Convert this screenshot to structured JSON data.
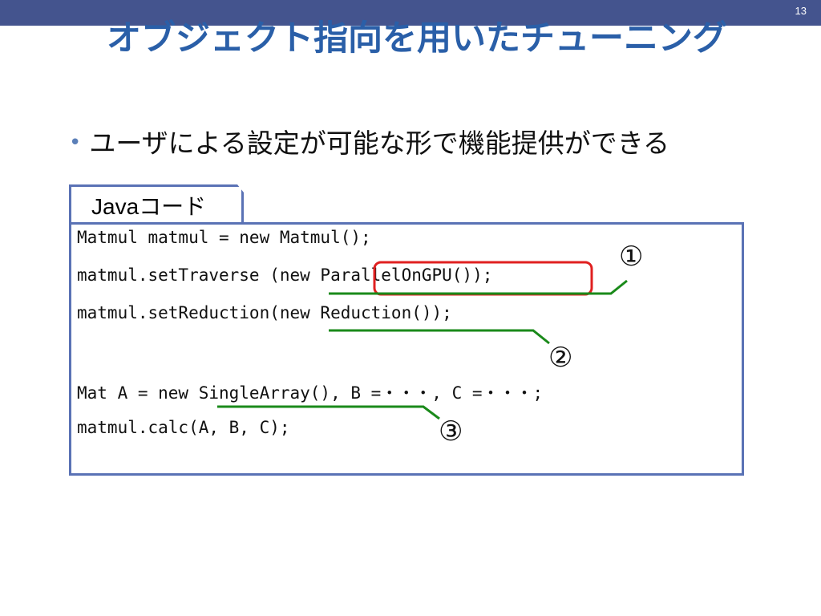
{
  "slide": {
    "page_number": "13",
    "title": "オブジェクト指向を用いたチューニング",
    "bullet": "ユーザによる設定が可能な形で機能提供ができる",
    "bullet_marker": "•"
  },
  "code_panel": {
    "tab_label": "Javaコード",
    "lines": [
      "Matmul matmul = new Matmul();",
      "matmul.setTraverse (new ParallelOnGPU());",
      "matmul.setReduction(new Reduction());",
      "Mat A = new SingleArray(), B =・・・, C =・・・;",
      "matmul.calc(A, B, C);"
    ]
  },
  "annotations": {
    "markers": [
      "①",
      "②",
      "③"
    ],
    "highlight_color": "#e02020",
    "underline_color": "#1a8a1a"
  },
  "colors": {
    "top_bar": "#44548e",
    "title": "#2a5fa8",
    "panel_border": "#5a72b5"
  }
}
